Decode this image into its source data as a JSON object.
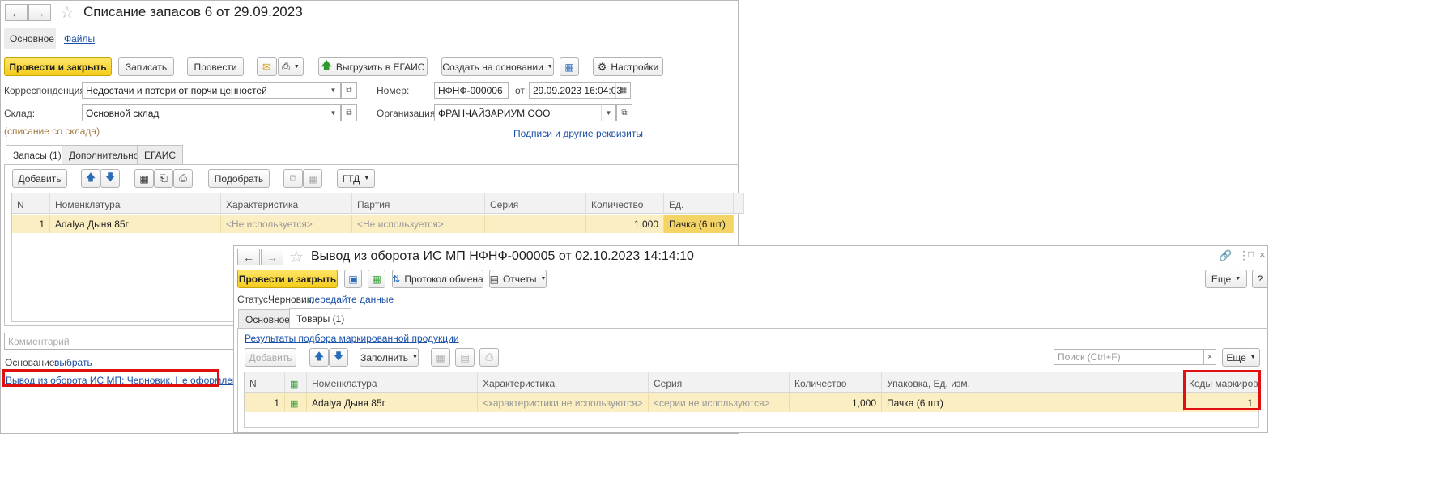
{
  "w1": {
    "title": "Списание запасов 6 от 29.09.2023",
    "nav_tabs": [
      "Основное",
      "Файлы"
    ],
    "toolbar": {
      "post_close": "Провести и закрыть",
      "save": "Записать",
      "post": "Провести",
      "upload": "Выгрузить в ЕГАИС",
      "create_based": "Создать на основании",
      "settings": "Настройки"
    },
    "form": {
      "corr_label": "Корреспонденция:",
      "corr_value": "Недостачи и потери от порчи ценностей",
      "warehouse_label": "Склад:",
      "warehouse_value": "Основной склад",
      "writeoff_note": "(списание со склада)",
      "number_label": "Номер:",
      "number_value": "НФНФ-000006",
      "date_label": "от:",
      "date_value": "29.09.2023 16:04:03",
      "org_label": "Организация:",
      "org_value": "ФРАНЧАЙЗАРИУМ ООО",
      "signatures_link": "Подписи и другие реквизиты"
    },
    "tabs": [
      "Запасы (1)",
      "Дополнительно",
      "ЕГАИС"
    ],
    "grid_toolbar": {
      "add": "Добавить",
      "pick": "Подобрать",
      "gtd": "ГТД"
    },
    "columns": [
      "N",
      "Номенклатура",
      "Характеристика",
      "Партия",
      "Серия",
      "Количество",
      "Ед."
    ],
    "rows": [
      {
        "n": "1",
        "item": "Adalya Дыня 85г",
        "char": "<Не используется>",
        "batch": "<Не используется>",
        "series": "",
        "qty": "1,000",
        "unit": "Пачка (6 шт)"
      }
    ],
    "comment_placeholder": "Комментарий",
    "basis_label": "Основание:",
    "basis_link": "выбрать",
    "doc_link": "Вывод из оборота ИС МП: Черновик, Не оформлено"
  },
  "w2": {
    "title": "Вывод из оборота ИС МП НФНФ-000005 от 02.10.2023 14:14:10",
    "toolbar": {
      "post_close": "Провести и закрыть",
      "protocol": "Протокол обмена",
      "reports": "Отчеты",
      "more": "Еще",
      "help": "?"
    },
    "status_label": "Статус:",
    "status_value": "Черновик,",
    "status_link": "передайте данные",
    "tabs": [
      "Основное",
      "Товары (1)"
    ],
    "results_link": "Результаты подбора маркированной продукции",
    "grid_toolbar": {
      "add": "Добавить",
      "fill": "Заполнить",
      "search_placeholder": "Поиск (Ctrl+F)",
      "more": "Еще"
    },
    "columns": [
      "N",
      "Номенклатура",
      "Характеристика",
      "Серия",
      "Количество",
      "Упаковка, Ед. изм.",
      "Коды маркировки"
    ],
    "rows": [
      {
        "n": "1",
        "item": "Adalya Дыня 85г",
        "char": "<характеристики не используются>",
        "series": "<серии не используются>",
        "qty": "1,000",
        "pack": "Пачка (6 шт)",
        "codes": "1"
      }
    ]
  },
  "colors": {
    "accent_yellow": "#f5cc1c",
    "link": "#1a4fa8",
    "highlight_red": "#e01010",
    "row_selected": "#fbeec2"
  }
}
